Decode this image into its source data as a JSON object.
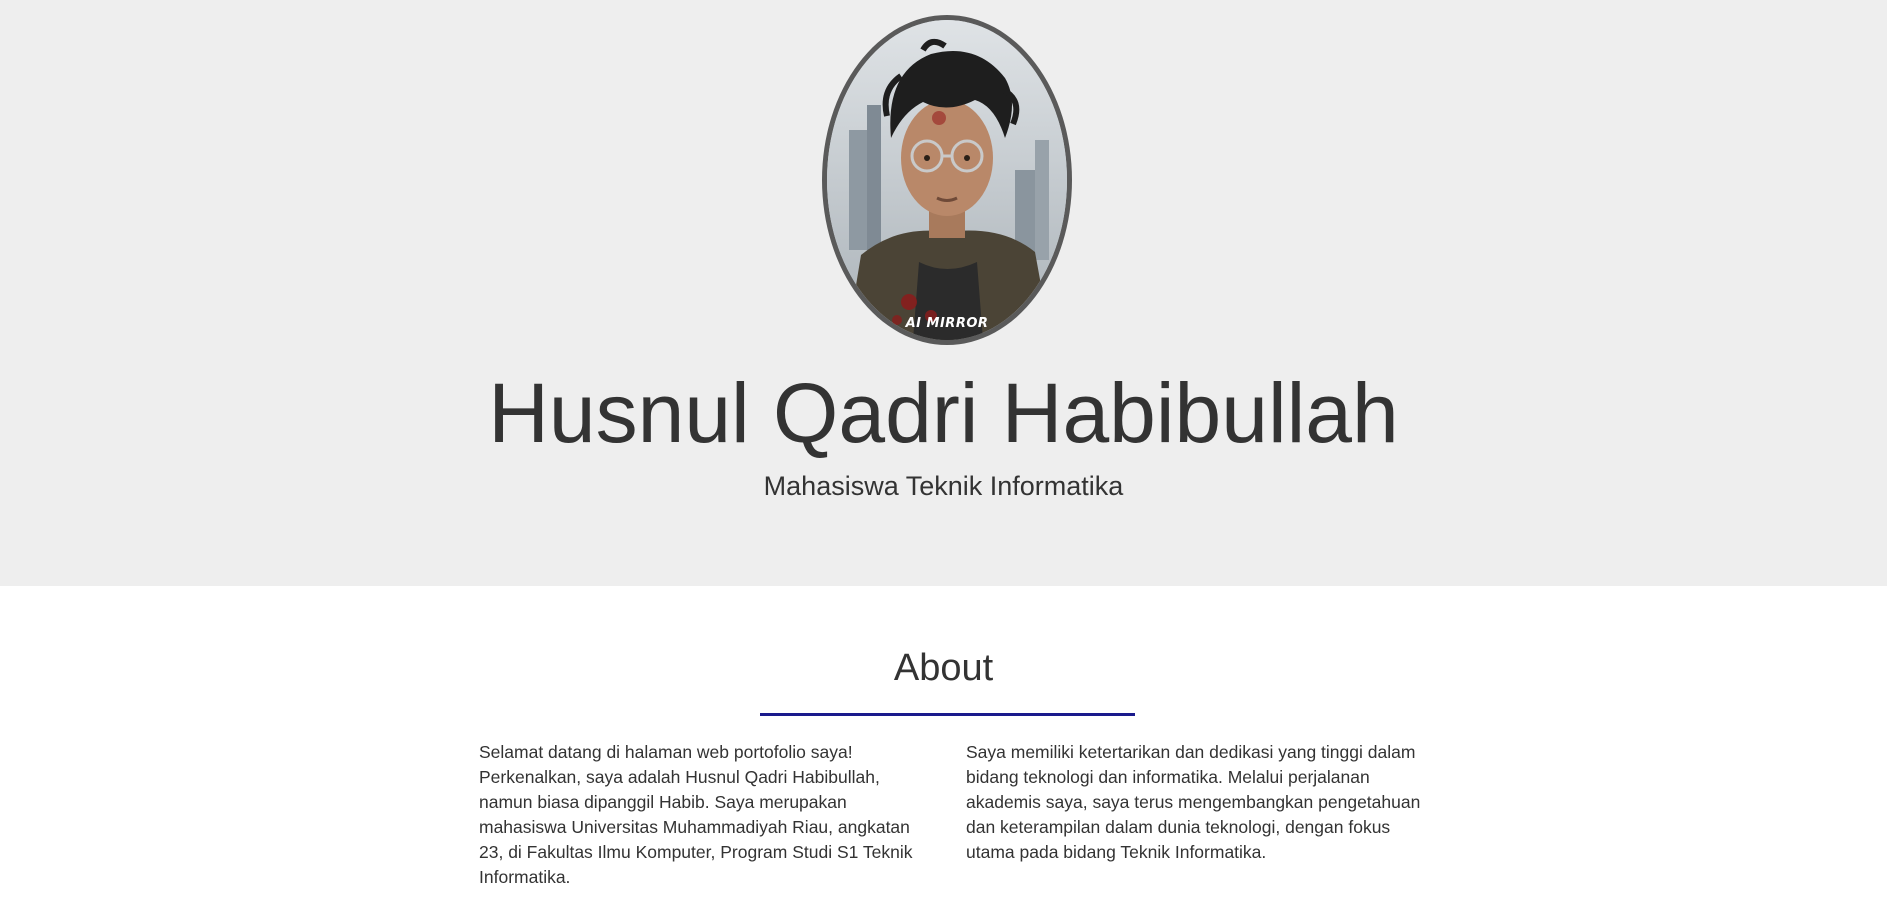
{
  "hero": {
    "avatar_watermark": "AI MIRROR",
    "name": "Husnul Qadri Habibullah",
    "role": "Mahasiswa Teknik Informatika",
    "background_color": "#eeeeee"
  },
  "about": {
    "title": "About",
    "divider_color": "#1a1a8c",
    "paragraph_left": "Selamat datang di halaman web portofolio saya! Perkenalkan, saya adalah Husnul Qadri Habibullah, namun biasa dipanggil Habib. Saya merupakan mahasiswa Universitas Muhammadiyah Riau, angkatan 23, di Fakultas Ilmu Komputer, Program Studi S1 Teknik Informatika.",
    "paragraph_right": "Saya memiliki ketertarikan dan dedikasi yang tinggi dalam bidang teknologi dan informatika. Melalui perjalanan akademis saya, saya terus mengembangkan pengetahuan dan keterampilan dalam dunia teknologi, dengan fokus utama pada bidang Teknik Informatika."
  }
}
